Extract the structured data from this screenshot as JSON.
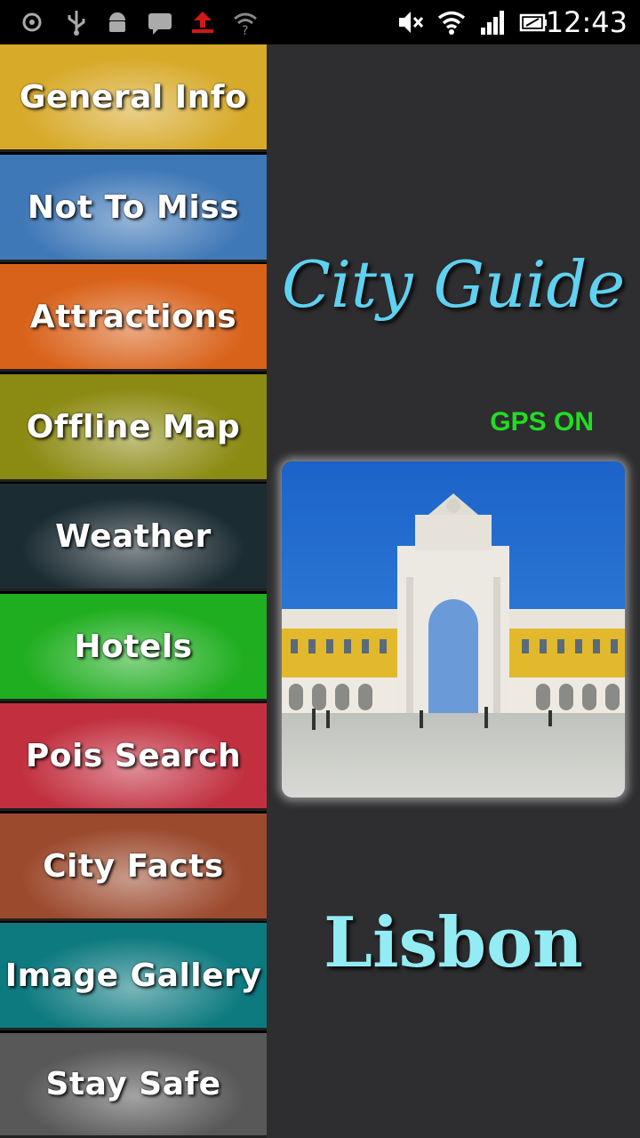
{
  "status_bar": {
    "time": "12:43",
    "icons": [
      "location-icon",
      "usb-icon",
      "android-icon",
      "message-icon",
      "upload-icon",
      "wifi-question-icon",
      "mute-icon",
      "wifi-icon",
      "signal-icon",
      "battery-icon"
    ]
  },
  "menu": {
    "items": [
      {
        "label": "General Info",
        "color": "#d7aa2a"
      },
      {
        "label": "Not To Miss",
        "color": "#3f78b7"
      },
      {
        "label": "Attractions",
        "color": "#d9621a"
      },
      {
        "label": "Offline Map",
        "color": "#8b8a12"
      },
      {
        "label": "Weather",
        "color": "#1c2c33"
      },
      {
        "label": "Hotels",
        "color": "#1fae1f"
      },
      {
        "label": "Pois Search",
        "color": "#c23040"
      },
      {
        "label": "City Facts",
        "color": "#9c4a2e"
      },
      {
        "label": "Image Gallery",
        "color": "#0d7a80"
      },
      {
        "label": "Stay Safe",
        "color": "#585858"
      }
    ]
  },
  "panel": {
    "title": "City Guide",
    "gps_status": "GPS ON",
    "city": "Lisbon"
  },
  "colors": {
    "panel_bg": "#2e2e30",
    "title": "#5fd1f1",
    "gps": "#22dd22",
    "city": "#93ecf4"
  }
}
